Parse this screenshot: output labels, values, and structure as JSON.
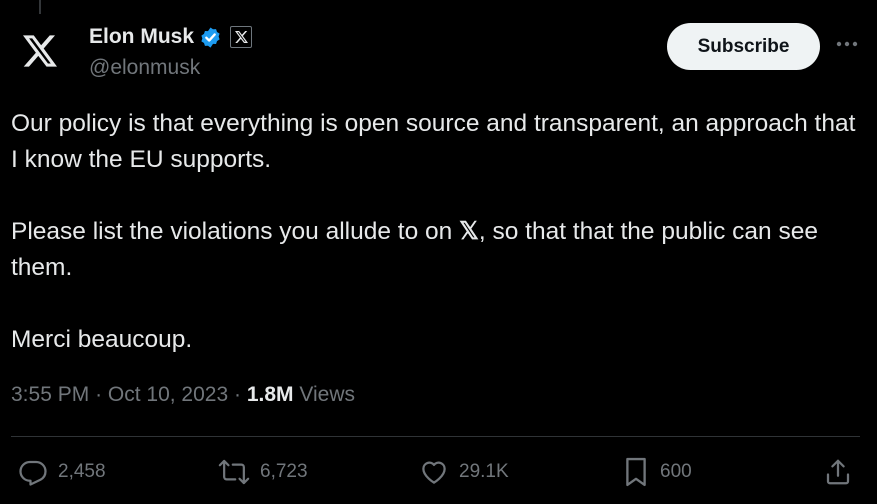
{
  "author": {
    "display_name": "Elon Musk",
    "handle": "@elonmusk",
    "affiliation_badge": "x-logo-icon",
    "verified_color": "#1d9bf0"
  },
  "subscribe_label": "Subscribe",
  "tweet": {
    "paragraphs": [
      {
        "before": "Our policy is that everything is open source and transparent, an approach that I know the EU supports.",
        "glyph": "",
        "after": ""
      },
      {
        "before": "Please list the violations you allude to on ",
        "glyph": "𝕏",
        "after": ", so that that the public can see them."
      },
      {
        "before": "Merci beaucoup.",
        "glyph": "",
        "after": ""
      }
    ]
  },
  "meta": {
    "time": "3:55 PM",
    "sep1": "·",
    "date": "Oct 10, 2023",
    "sep2": "·",
    "views_count": "1.8M",
    "views_label": "Views"
  },
  "actions": {
    "replies": "2,458",
    "reposts": "6,723",
    "likes": "29.1K",
    "bookmarks": "600"
  },
  "colors": {
    "background": "#000000",
    "text": "#e7e9ea",
    "secondary": "#71767b",
    "divider": "#2f3336",
    "button_bg": "#eff3f4"
  }
}
